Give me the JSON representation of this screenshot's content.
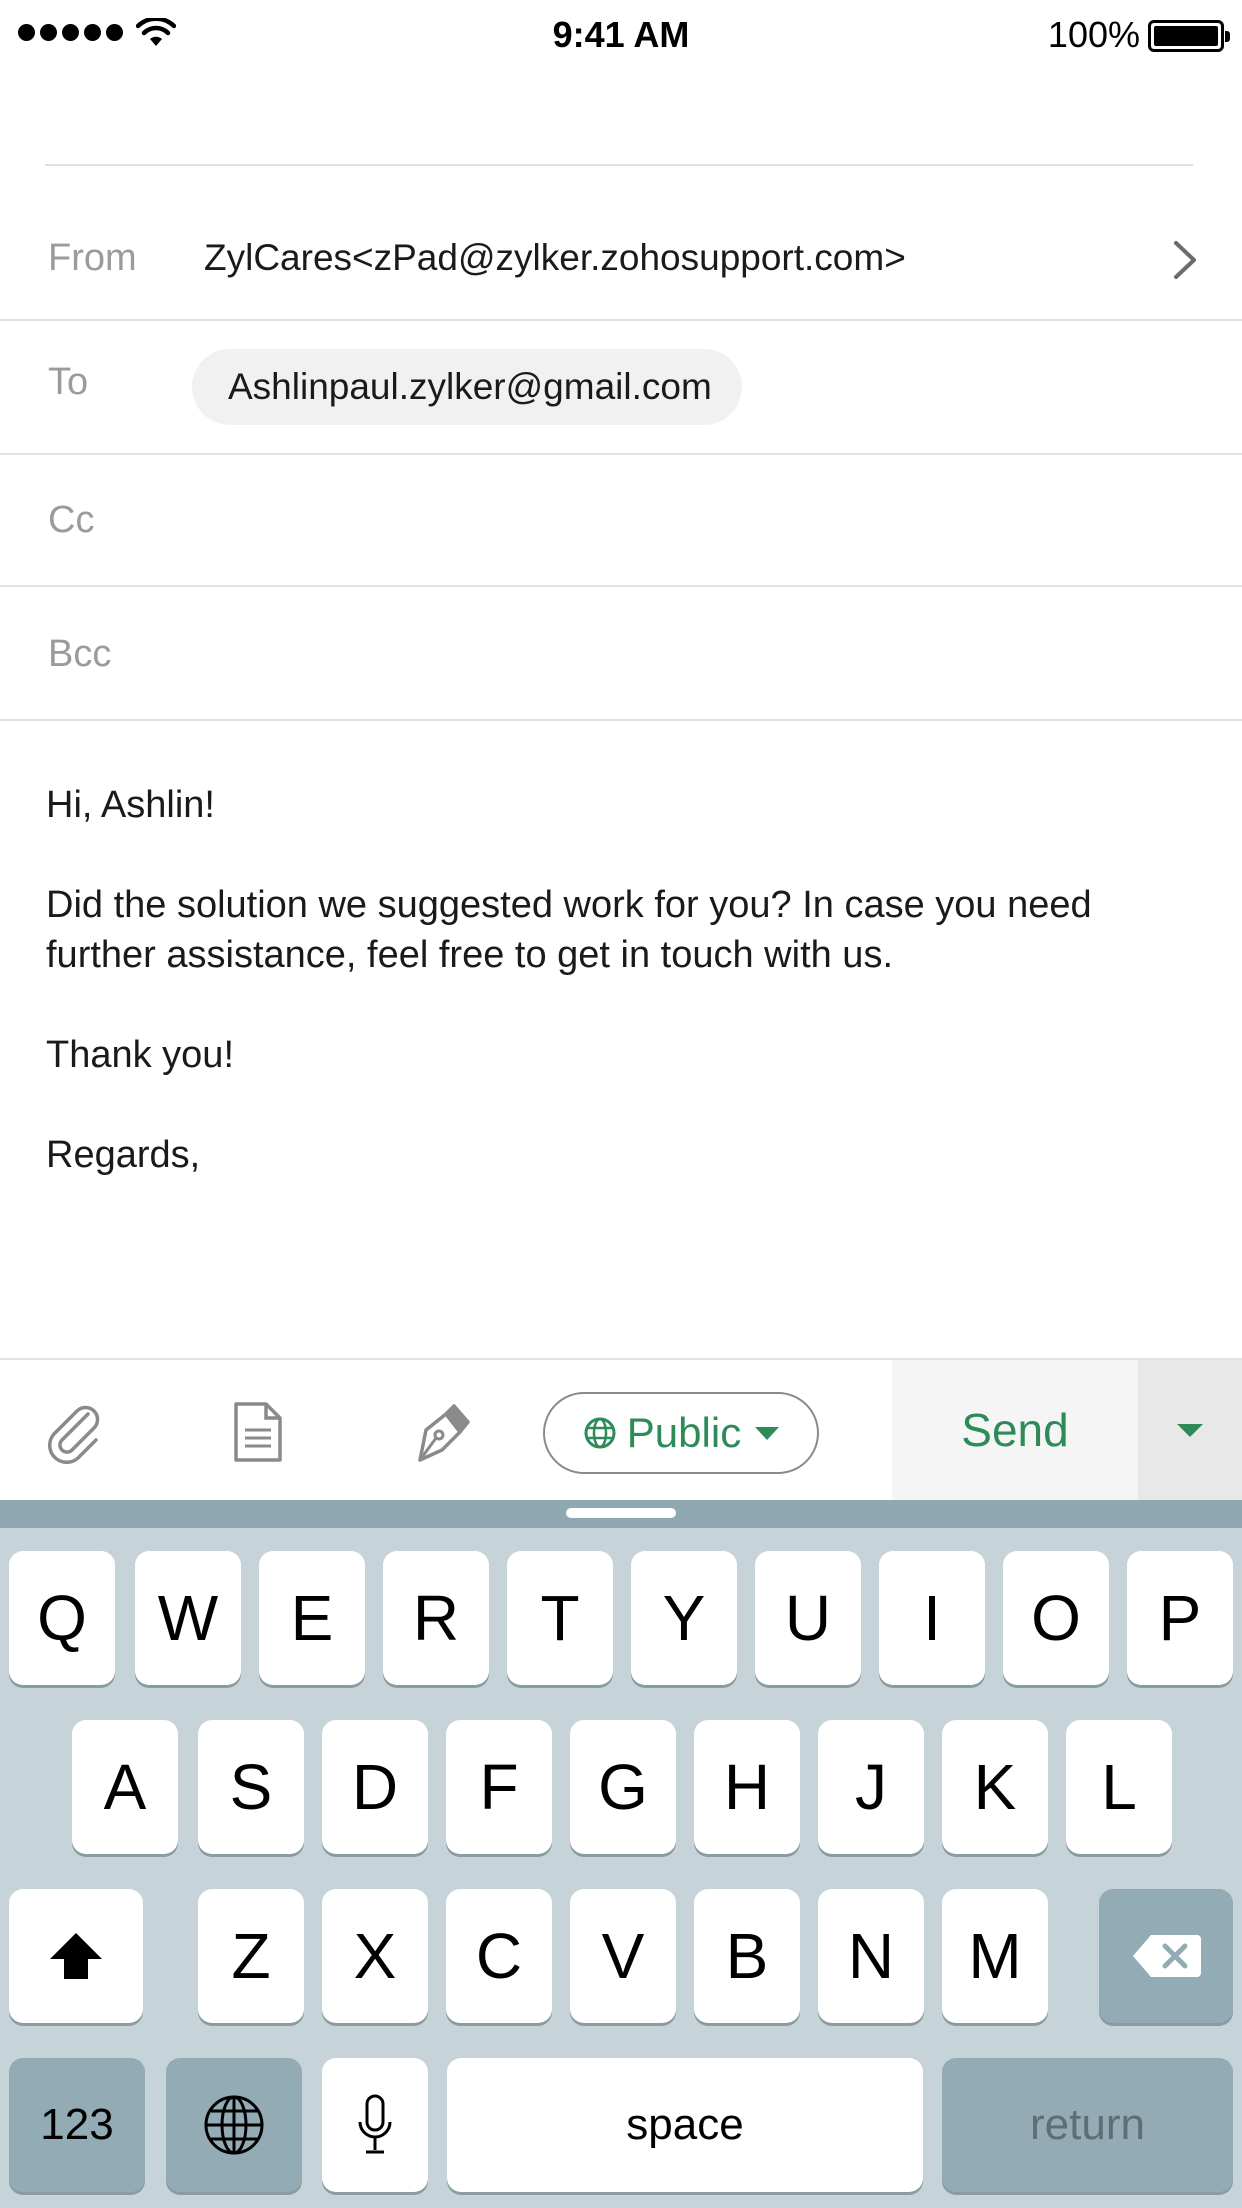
{
  "status_bar": {
    "time": "9:41 AM",
    "battery_percent": "100%",
    "signal_icon": "signal-dots-icon",
    "wifi_icon": "wifi-icon",
    "battery_icon": "battery-icon"
  },
  "compose": {
    "from": {
      "label": "From",
      "value": "ZylCares<zPad@zylker.zohosupport.com>"
    },
    "to": {
      "label": "To",
      "recipient": "Ashlinpaul.zylker@gmail.com"
    },
    "cc": {
      "label": "Cc"
    },
    "bcc": {
      "label": "Bcc"
    },
    "body": {
      "greeting": "Hi, Ashlin!",
      "paragraph": "Did the solution we suggested work for you? In case you need further assistance, feel free to get in touch with us.",
      "thanks": "Thank you!",
      "signoff": "Regards,"
    }
  },
  "toolbar": {
    "attach_icon": "paperclip-icon",
    "template_icon": "document-icon",
    "signature_icon": "pen-nib-icon",
    "visibility_label": "Public",
    "send_label": "Send",
    "accent_color": "#2e8b57"
  },
  "keyboard": {
    "row1": [
      "Q",
      "W",
      "E",
      "R",
      "T",
      "Y",
      "U",
      "I",
      "O",
      "P"
    ],
    "row2": [
      "A",
      "S",
      "D",
      "F",
      "G",
      "H",
      "J",
      "K",
      "L"
    ],
    "row3": [
      "Z",
      "X",
      "C",
      "V",
      "B",
      "N",
      "M"
    ],
    "numbers_label": "123",
    "space_label": "space",
    "return_label": "return"
  }
}
